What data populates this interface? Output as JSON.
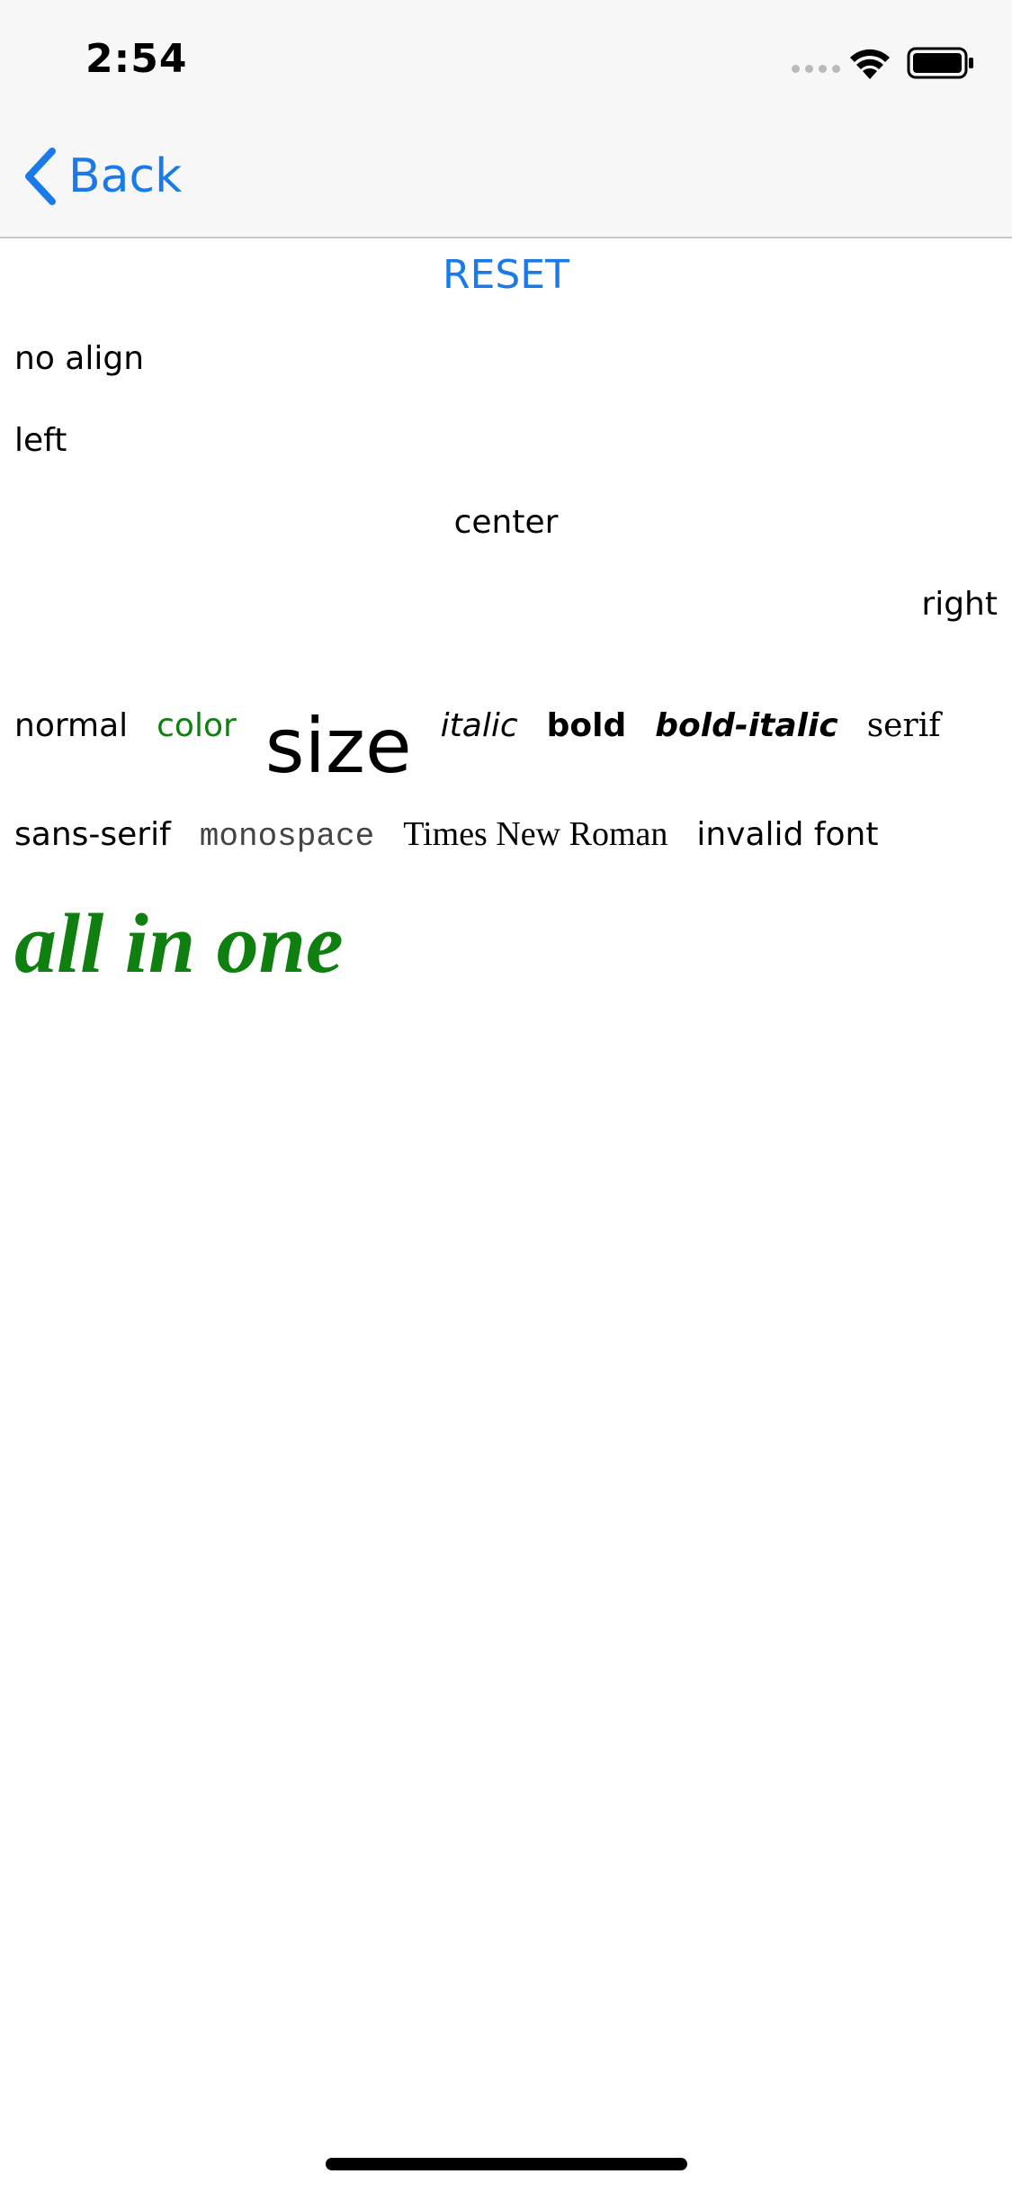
{
  "status_bar": {
    "time": "2:54"
  },
  "nav": {
    "back_label": "Back"
  },
  "reset_label": "RESET",
  "alignment": {
    "no_align": "no align",
    "left": "left",
    "center": "center",
    "right": "right"
  },
  "styles_row": {
    "normal": "normal",
    "color": "color",
    "size": "size",
    "italic": "italic",
    "bold": "bold",
    "bold_italic": "bold-italic",
    "serif": "serif"
  },
  "fonts_row": {
    "sans_serif": "sans-serif",
    "monospace": "monospace",
    "times": "Times New Roman",
    "invalid": "invalid font"
  },
  "all_in_one": "all in one",
  "colors": {
    "accent": "#1a7be8",
    "green": "#0f8010"
  }
}
